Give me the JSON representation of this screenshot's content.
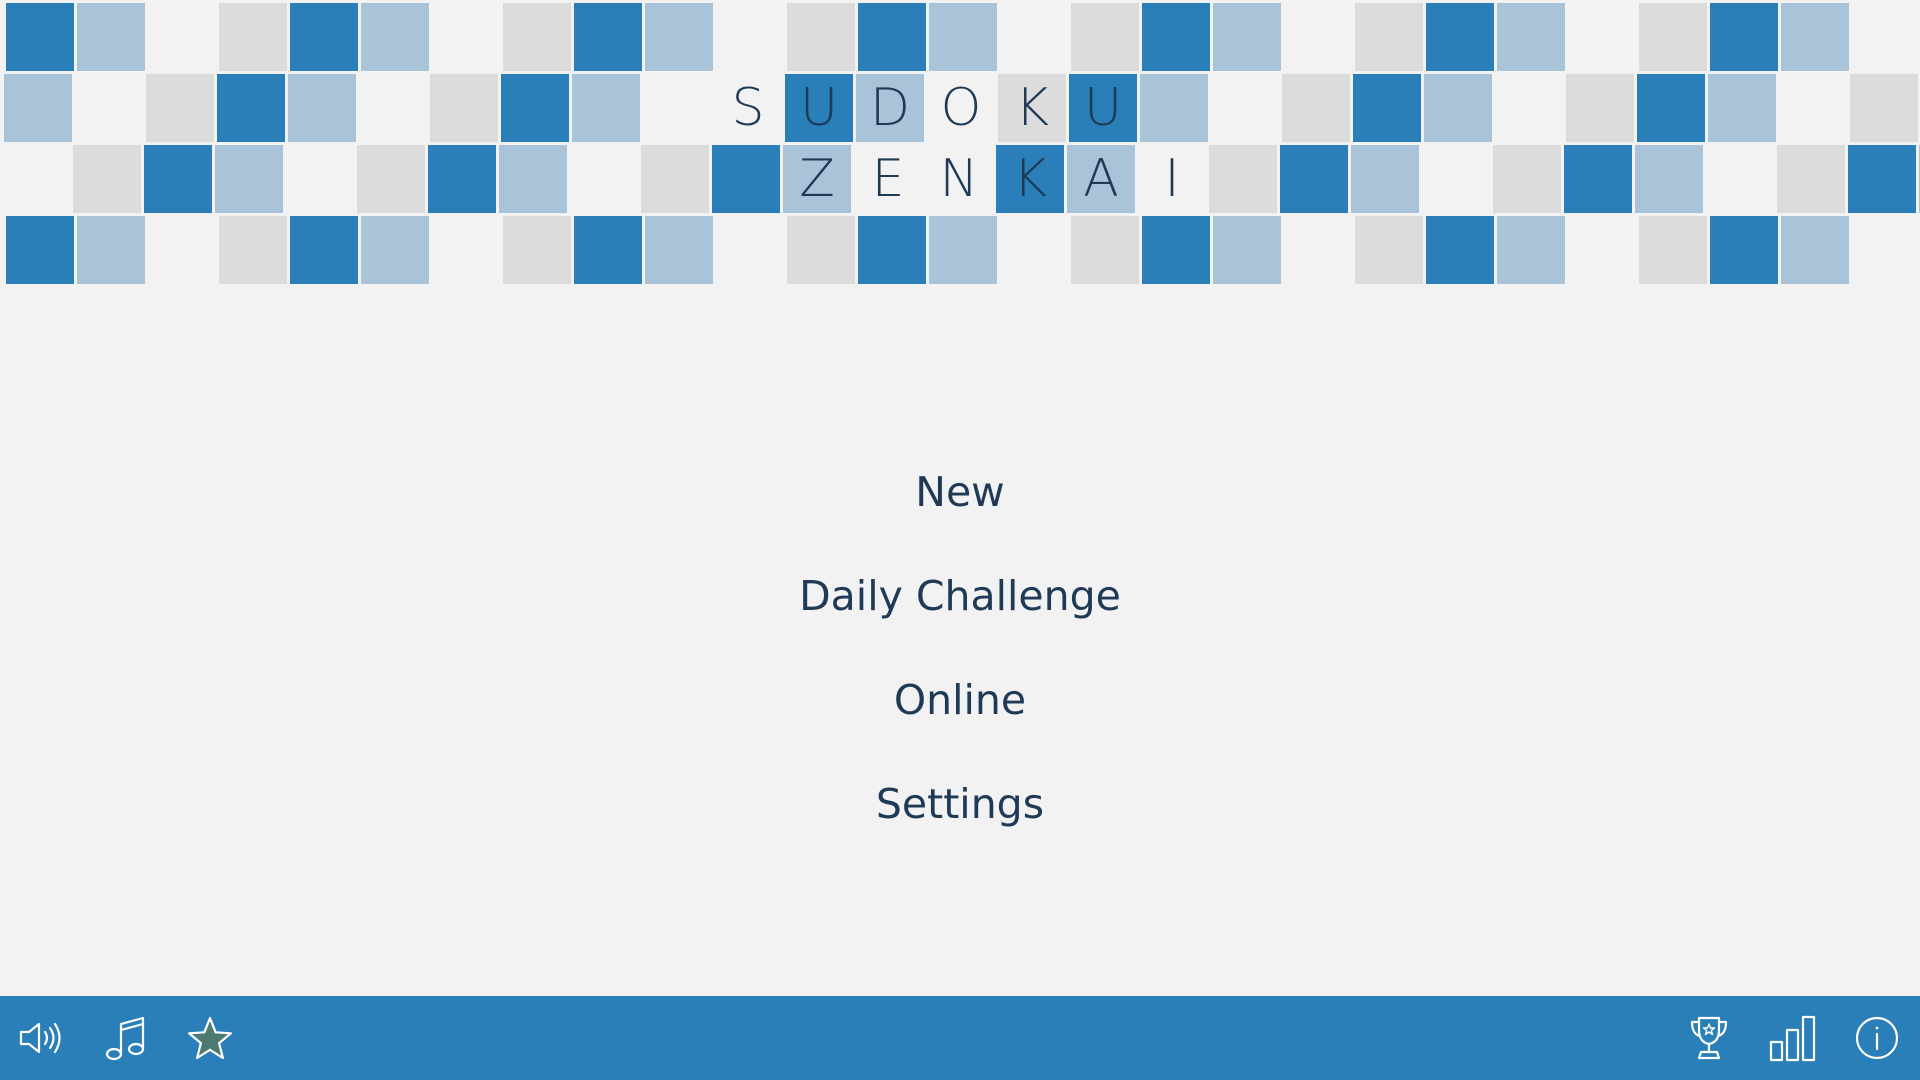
{
  "app": {
    "title_line1": [
      "S",
      "U",
      "D",
      "O",
      "K",
      "U"
    ],
    "title_line2": [
      "Z",
      "E",
      "N",
      "K",
      "A",
      "I"
    ]
  },
  "menu": {
    "new_label": "New",
    "daily_label": "Daily Challenge",
    "online_label": "Online",
    "settings_label": "Settings"
  },
  "toolbar": {
    "left": [
      "speaker-icon",
      "music-note-icon",
      "star-icon"
    ],
    "right": [
      "trophy-icon",
      "bar-chart-icon",
      "info-icon"
    ]
  },
  "colors": {
    "primary": "#2a7fb8",
    "light": "#a9c4d9",
    "gray": "#dcdcdc",
    "background": "#f2f2f2",
    "text": "#1e3a56",
    "star_fill": "#4d7a70"
  }
}
